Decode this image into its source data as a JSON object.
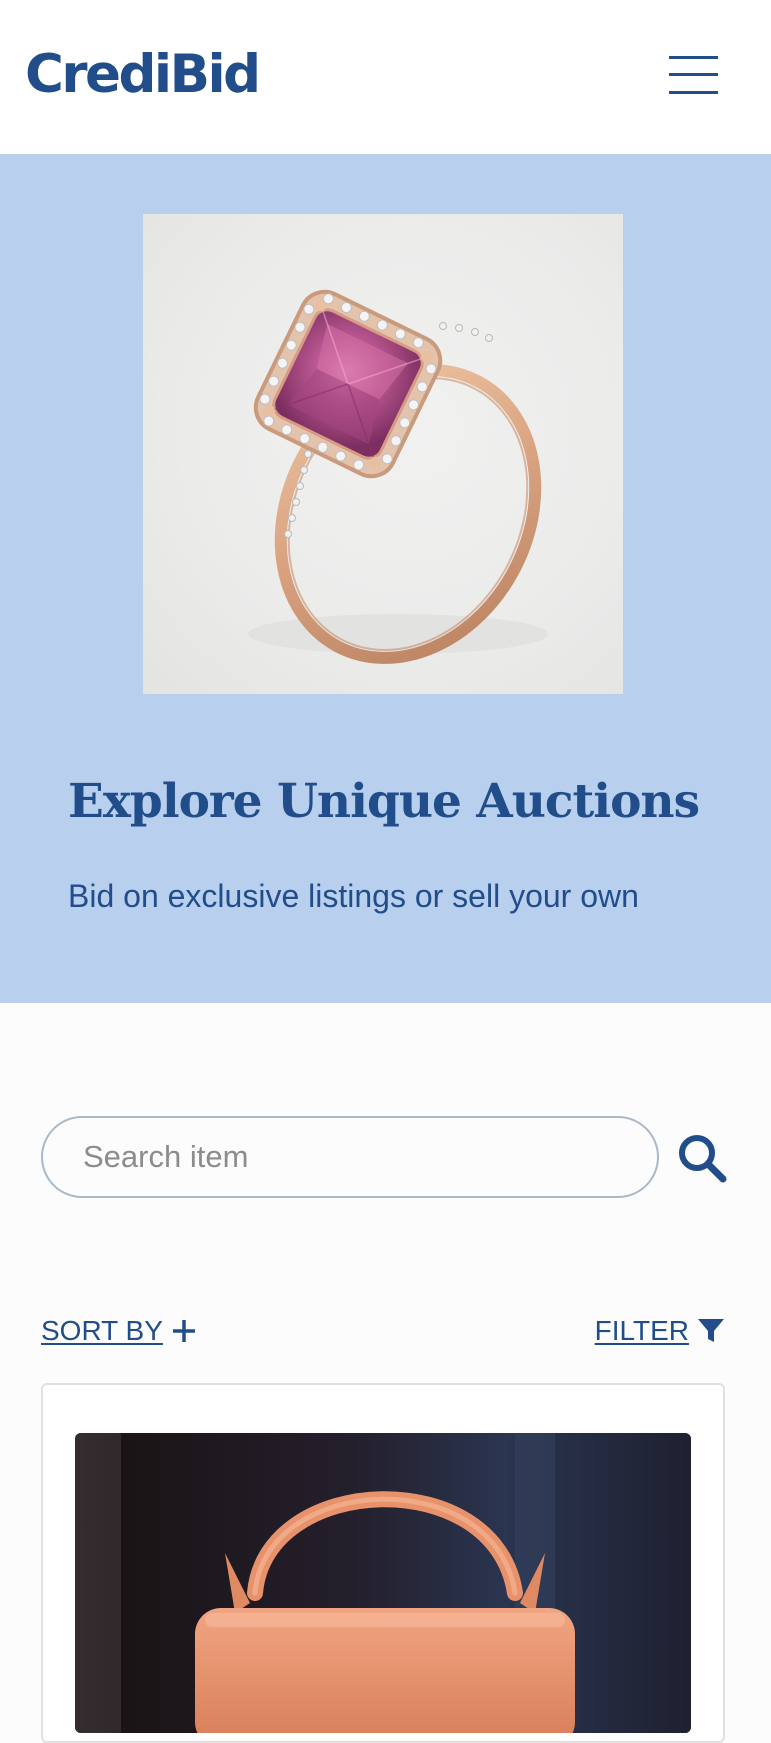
{
  "header": {
    "logo_text": "CrediBid",
    "menu_icon": "hamburger-menu-icon"
  },
  "hero": {
    "image": "pink-gemstone-ring-photo",
    "title": "Explore Unique Auctions",
    "subtitle": "Bid on exclusive listings or sell your own"
  },
  "search": {
    "placeholder": "Search item",
    "value": "",
    "icon": "search-icon"
  },
  "controls": {
    "sort_label": "SORT BY",
    "sort_icon": "plus-icon",
    "filter_label": "FILTER",
    "filter_icon": "filter-funnel-icon"
  },
  "listings": [
    {
      "image": "orange-handbag-photo"
    }
  ],
  "colors": {
    "brand": "#214e8a",
    "hero_background": "#b9cfee",
    "page_background": "#fcfcfc",
    "input_border": "#a9b9c8"
  }
}
